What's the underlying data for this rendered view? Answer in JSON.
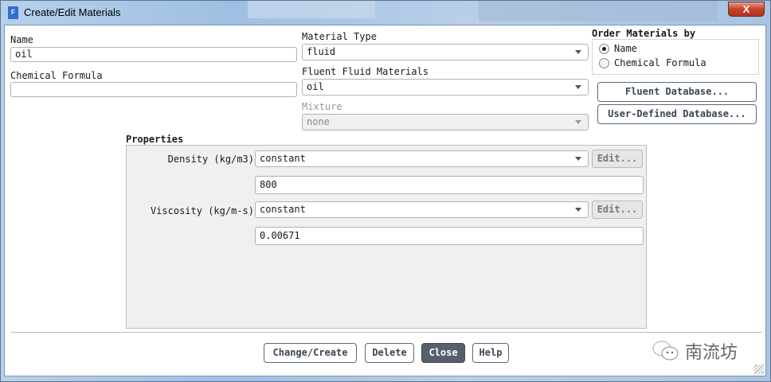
{
  "window": {
    "title": "Create/Edit Materials",
    "app_icon_letter": "F",
    "close_glyph": "X"
  },
  "form": {
    "name_label": "Name",
    "name_value": "oil",
    "formula_label": "Chemical Formula",
    "formula_value": "",
    "material_type_label": "Material Type",
    "material_type_value": "fluid",
    "fluent_materials_label": "Fluent Fluid Materials",
    "fluent_materials_value": "oil",
    "mixture_label": "Mixture",
    "mixture_value": "none"
  },
  "order": {
    "label": "Order Materials by",
    "options": [
      {
        "label": "Name",
        "selected": true
      },
      {
        "label": "Chemical Formula",
        "selected": false
      }
    ]
  },
  "db_buttons": {
    "fluent": "Fluent Database...",
    "user": "User-Defined Database..."
  },
  "properties": {
    "label": "Properties",
    "rows": [
      {
        "label": "Density (kg/m3)",
        "method": "constant",
        "value": "800",
        "edit": "Edit..."
      },
      {
        "label": "Viscosity (kg/m-s)",
        "method": "constant",
        "value": "0.00671",
        "edit": "Edit..."
      }
    ]
  },
  "buttons": {
    "change": "Change/Create",
    "delete": "Delete",
    "close": "Close",
    "help": "Help"
  },
  "watermark": "南流坊"
}
